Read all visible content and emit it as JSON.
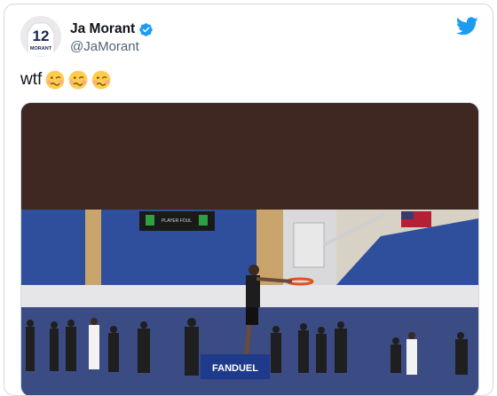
{
  "tweet": {
    "author": {
      "display_name": "Ja Morant",
      "handle": "@JaMorant",
      "verified": true,
      "avatar": {
        "jersey_number": "12",
        "jersey_name": "MORANT"
      }
    },
    "text": "wtf",
    "emojis": [
      "woozy-face",
      "woozy-face",
      "woozy-face"
    ],
    "media": {
      "type": "video",
      "sponsor_banner": "FANDUEL",
      "scoreboard": "PLAYER FOUL"
    }
  },
  "icons": {
    "brand": "twitter-bird-icon",
    "verified": "verified-badge-icon"
  },
  "colors": {
    "twitter_blue": "#1d9bf0",
    "name_text": "#0f1419",
    "handle_text": "#536471",
    "media_letterbox": "#3f2722",
    "gym_wall_blue": "#2f4f9c",
    "court_floor": "#3b4b84"
  }
}
